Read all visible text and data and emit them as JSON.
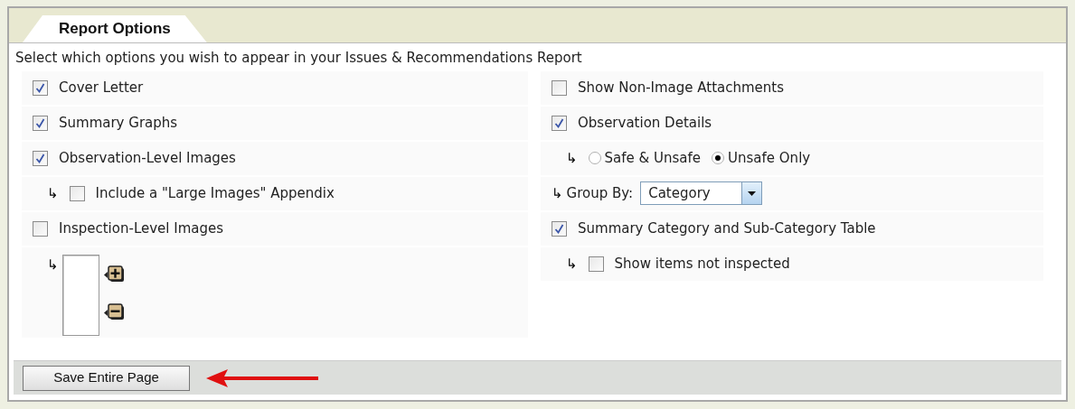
{
  "tab": {
    "label": "Report Options",
    "selected": true
  },
  "intro": "Select which options you wish to appear in your Issues & Recommendations Report",
  "left": [
    {
      "kind": "checkbox",
      "label": "Cover Letter",
      "checked": true
    },
    {
      "kind": "checkbox",
      "label": "Summary Graphs",
      "checked": true
    },
    {
      "kind": "checkbox",
      "label": "Observation-Level Images",
      "checked": true
    },
    {
      "kind": "sub_checkbox",
      "marker": "↳",
      "label": "Include a \"Large Images\" Appendix",
      "checked": false
    },
    {
      "kind": "checkbox",
      "label": "Inspection-Level Images",
      "checked": false
    },
    {
      "kind": "listbox",
      "marker": "↳"
    }
  ],
  "right": [
    {
      "kind": "checkbox",
      "label": "Show Non-Image Attachments",
      "checked": false
    },
    {
      "kind": "checkbox",
      "label": "Observation Details",
      "checked": true
    },
    {
      "kind": "radio_group",
      "marker": "↳",
      "options": [
        {
          "label": "Safe & Unsafe",
          "selected": false
        },
        {
          "label": "Unsafe Only",
          "selected": true
        }
      ]
    },
    {
      "kind": "select",
      "marker": "↳",
      "label": "Group By:",
      "value": "Category"
    },
    {
      "kind": "checkbox",
      "label": "Summary Category and Sub-Category Table",
      "checked": true
    },
    {
      "kind": "sub_checkbox",
      "marker": "↳",
      "label": "Show items not inspected",
      "checked": false
    }
  ],
  "save_button": "Save Entire Page"
}
